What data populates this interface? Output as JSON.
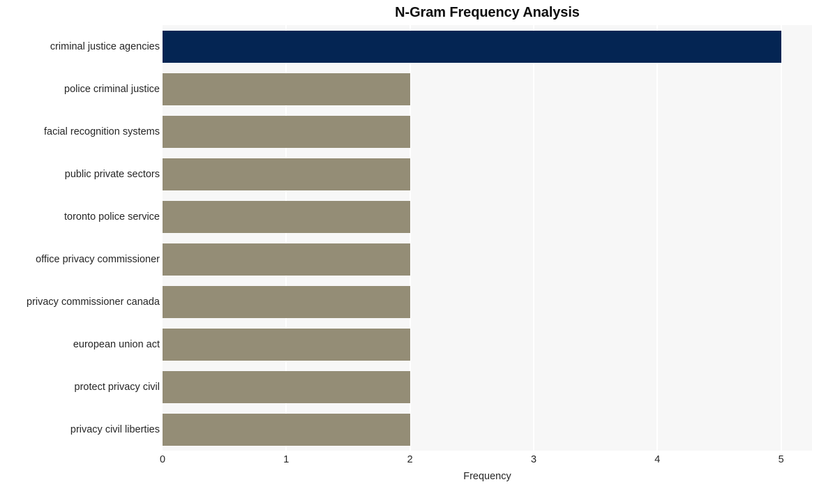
{
  "chart_data": {
    "type": "bar",
    "orientation": "horizontal",
    "title": "N-Gram Frequency Analysis",
    "xlabel": "Frequency",
    "ylabel": "",
    "xlim": [
      0,
      5.25
    ],
    "xticks": [
      0,
      1,
      2,
      3,
      4,
      5
    ],
    "xtick_labels": [
      "0",
      "1",
      "2",
      "3",
      "4",
      "5"
    ],
    "grid": "vertical-white-on-light-gray",
    "legend": null,
    "categories": [
      "criminal justice agencies",
      "police criminal justice",
      "facial recognition systems",
      "public private sectors",
      "toronto police service",
      "office privacy commissioner",
      "privacy commissioner canada",
      "european union act",
      "protect privacy civil",
      "privacy civil liberties"
    ],
    "values": [
      5,
      2,
      2,
      2,
      2,
      2,
      2,
      2,
      2,
      2
    ],
    "bar_colors": [
      "#042553",
      "#948d76",
      "#948d76",
      "#948d76",
      "#948d76",
      "#948d76",
      "#948d76",
      "#948d76",
      "#948d76",
      "#948d76"
    ]
  },
  "style": {
    "plot_background": "#f7f7f7",
    "figure_background": "#ffffff",
    "gridline_color": "#ffffff",
    "highlight_color": "#042553",
    "bar_color": "#948d76",
    "text_color": "#262626",
    "title_color": "#0e0e0e"
  }
}
